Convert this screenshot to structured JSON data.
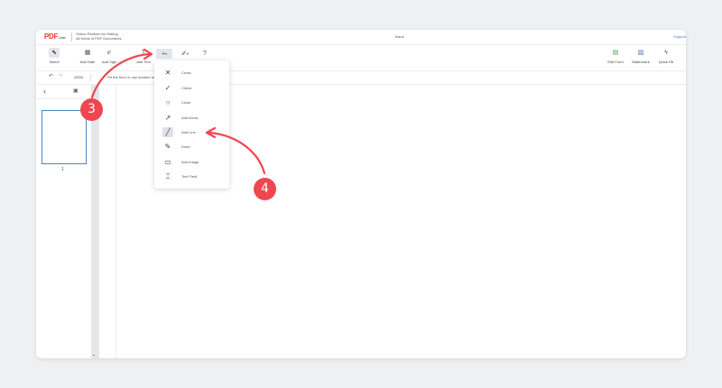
{
  "header": {
    "logo": "PDF",
    "logo_suffix": "Liner",
    "tagline_1": "Online Platform for Editing",
    "tagline_2": "All Kinds of PDF Documents",
    "doc_title": "blank",
    "support": "Support"
  },
  "toolbar": {
    "select": "Select",
    "add_date": "Add Date",
    "add_sign": "Add Sign",
    "add_text": "Add Text",
    "help": "?",
    "edit_form": "Edit Form",
    "watermark": "Watermark",
    "quick_fill": "Quick Fill"
  },
  "subbar": {
    "zoom": "200%",
    "hint": "Fill the form or use another tool"
  },
  "sidebar": {
    "page_number": "1"
  },
  "dropdown": {
    "items": [
      {
        "label": "Cross",
        "icon": "cross-icon"
      },
      {
        "label": "Check",
        "icon": "check-icon"
      },
      {
        "label": "Circle",
        "icon": "circle-icon"
      },
      {
        "label": "Add Arrow",
        "icon": "arrow-icon"
      },
      {
        "label": "Add Line",
        "icon": "line-icon"
      },
      {
        "label": "Draw",
        "icon": "pen-icon"
      },
      {
        "label": "Add Image",
        "icon": "image-icon"
      },
      {
        "label": "Text Field",
        "icon": "text-field-icon"
      }
    ]
  },
  "annotations": {
    "step_3": "3",
    "step_4": "4"
  },
  "colors": {
    "accent": "#f0464f",
    "link": "#4a74c9",
    "thumb_border": "#4a88c7"
  }
}
